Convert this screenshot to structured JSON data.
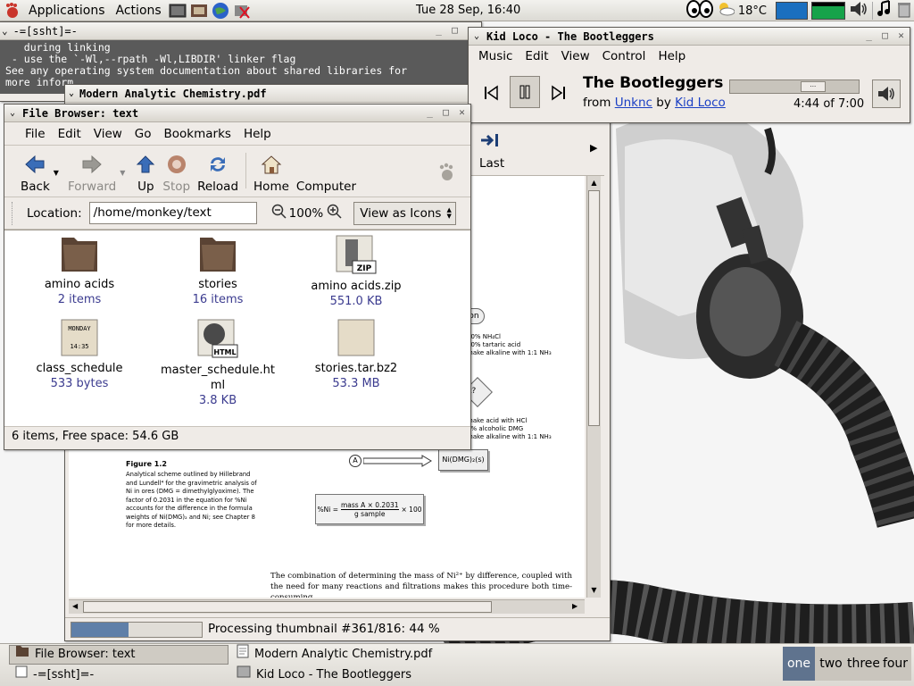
{
  "panel": {
    "applications": "Applications",
    "actions": "Actions",
    "clock": "Tue 28 Sep, 16:40",
    "temperature": "18°C"
  },
  "terminal": {
    "title": "-=[ssht]=-",
    "lines": [
      "   during linking",
      " - use the `-Wl,--rpath -Wl,LIBDIR' linker flag",
      "",
      "See any operating system documentation about shared libraries for",
      "more inform"
    ]
  },
  "pdf": {
    "title": "Modern Analytic Chemistry.pdf",
    "sidebar_last": "Last",
    "figure_label": "Figure 1.2",
    "caption": "Analytical scheme outlined by Hillebrand and Lundell⁴ for the gravimetric analysis of Ni in ores (DMG = dimethylglyoxime). The factor of 0.2031 in the equation for %Ni accounts for the difference in the formula weights of Ni(DMG)₂ and Ni; see Chapter 8 for more details.",
    "formula_left": "%Ni =",
    "formula_num": "mass A × 0.2031",
    "formula_den": "g sample",
    "formula_right": "× 100",
    "node_a": "A",
    "node_result": "Ni(DMG)₂(s)",
    "step1": [
      "20% NH₄Cl",
      "10% tartaric acid",
      "make alkaline with 1:1 NH₃"
    ],
    "step2": [
      "make acid with HCl",
      "1% alcoholic DMG",
      "make alkaline with 1:1 NH₃"
    ],
    "node_on": "on",
    "node_q": "t?",
    "body_text": "The combination of determining the mass of Ni²⁺ by difference, coupled with the need for many reactions and filtrations makes this procedure both time-consuming",
    "status": "Processing thumbnail #361/816:  44 %",
    "progress": 0.44
  },
  "music": {
    "title": "Kid Loco  - The Bootleggers",
    "menus": [
      "Music",
      "Edit",
      "View",
      "Control",
      "Help"
    ],
    "song": "The Bootleggers",
    "from": "from",
    "album": "Unknc",
    "by": "by",
    "artist": "Kid Loco",
    "time": "4:44 of 7:00",
    "seek_fraction": 0.68
  },
  "filebrowser": {
    "title": "File Browser: text",
    "menus": [
      "File",
      "Edit",
      "View",
      "Go",
      "Bookmarks",
      "Help"
    ],
    "toolbar": {
      "back": "Back",
      "forward": "Forward",
      "up": "Up",
      "stop": "Stop",
      "reload": "Reload",
      "home": "Home",
      "computer": "Computer"
    },
    "location_label": "Location:",
    "location": "/home/monkey/text",
    "zoom": "100%",
    "view_as": "View as Icons",
    "files": [
      {
        "name": "amino acids",
        "meta": "2 items",
        "icon": "folder-icon"
      },
      {
        "name": "stories",
        "meta": "16 items",
        "icon": "folder-icon"
      },
      {
        "name": "amino acids.zip",
        "meta": "551.0 KB",
        "icon": "zip-archive-icon"
      },
      {
        "name": "class_schedule",
        "meta": "533 bytes",
        "icon": "calendar-file-icon",
        "badge1": "MONDAY",
        "badge2": "14:35"
      },
      {
        "name": "master_schedule.ht",
        "name2": "ml",
        "meta": "3.8 KB",
        "icon": "html-file-icon",
        "badge1": "HTML"
      },
      {
        "name": "stories.tar.bz2",
        "meta": "53.3 MB",
        "icon": "archive-icon"
      }
    ],
    "status": "6 items, Free space: 54.6 GB"
  },
  "taskbar": {
    "tasks": [
      "File Browser: text",
      "Modern Analytic Chemistry.pdf",
      "-=[ssht]=-",
      "Kid Loco  - The Bootleggers"
    ],
    "workspaces": [
      "one",
      "two",
      "three",
      "four"
    ]
  }
}
